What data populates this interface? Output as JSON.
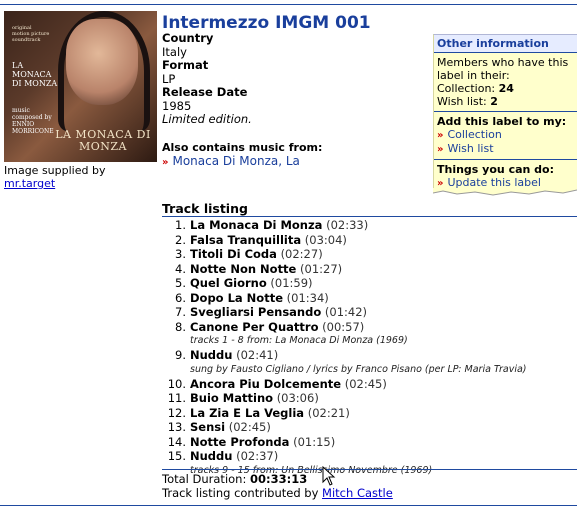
{
  "release": {
    "title": "Intermezzo IMGM 001",
    "country_label": "Country",
    "country": "Italy",
    "format_label": "Format",
    "format": "LP",
    "release_date_label": "Release Date",
    "release_date": "1985",
    "edition": "Limited edition."
  },
  "cover": {
    "line1": "original",
    "line2": "motion picture",
    "line3": "soundtrack",
    "title_top": "LA MONACA DI MONZA",
    "composed_by": "music composed by",
    "composer": "ENNIO MORRICONE",
    "title_bottom": "LA MONACA DI MONZA"
  },
  "image_caption": {
    "text": "Image supplied by",
    "user": "mr.target"
  },
  "also": {
    "label": "Also contains music from:",
    "link": "Monaca Di Monza, La"
  },
  "sidebar": {
    "header": "Other information",
    "members_text": "Members who have this label in their:",
    "collection_label": "Collection:",
    "collection_count": "24",
    "wishlist_label": "Wish list:",
    "wishlist_count": "2",
    "add_title": "Add this label to my:",
    "add_collection": "Collection",
    "add_wishlist": "Wish list",
    "things_title": "Things you can do:",
    "update_label": "Update this label"
  },
  "tracklisting": {
    "header": "Track listing",
    "tracks": [
      {
        "num": "1.",
        "name": "La Monaca Di Monza",
        "dur": "(02:33)"
      },
      {
        "num": "2.",
        "name": "Falsa Tranquillita",
        "dur": "(03:04)"
      },
      {
        "num": "3.",
        "name": "Titoli Di Coda",
        "dur": "(02:27)"
      },
      {
        "num": "4.",
        "name": "Notte Non Notte",
        "dur": "(01:27)"
      },
      {
        "num": "5.",
        "name": "Quel Giorno",
        "dur": "(01:59)"
      },
      {
        "num": "6.",
        "name": "Dopo La Notte",
        "dur": "(01:34)"
      },
      {
        "num": "7.",
        "name": "Svegliarsi Pensando",
        "dur": "(01:42)"
      },
      {
        "num": "8.",
        "name": "Canone Per Quattro",
        "dur": "(00:57)"
      },
      {
        "num": "9.",
        "name": "Nuddu",
        "dur": "(02:41)"
      },
      {
        "num": "10.",
        "name": "Ancora Piu Dolcemente",
        "dur": "(02:45)"
      },
      {
        "num": "11.",
        "name": "Buio Mattino",
        "dur": "(03:06)"
      },
      {
        "num": "12.",
        "name": "La Zia E La Veglia",
        "dur": "(02:21)"
      },
      {
        "num": "13.",
        "name": "Sensi",
        "dur": "(02:45)"
      },
      {
        "num": "14.",
        "name": "Notte Profonda",
        "dur": "(01:15)"
      },
      {
        "num": "15.",
        "name": "Nuddu",
        "dur": "(02:37)"
      }
    ],
    "note_after_8": "tracks 1 - 8 from: La Monaca Di Monza (1969)",
    "note_after_9": "sung by Fausto Cigliano / lyrics by Franco Pisano (per LP: Maria Travia)",
    "note_after_15": "tracks 9 - 15 from: Un Bellissimo Novembre (1969)",
    "total_label": "Total Duration:",
    "total": "00:33:13",
    "contrib_label": "Track listing contributed by",
    "contrib_user": "Mitch Castle"
  },
  "colors": {
    "link_blue": "#1a3f9c",
    "sidebar_bg": "#ffffcc",
    "arrow_red": "#cc0000"
  }
}
